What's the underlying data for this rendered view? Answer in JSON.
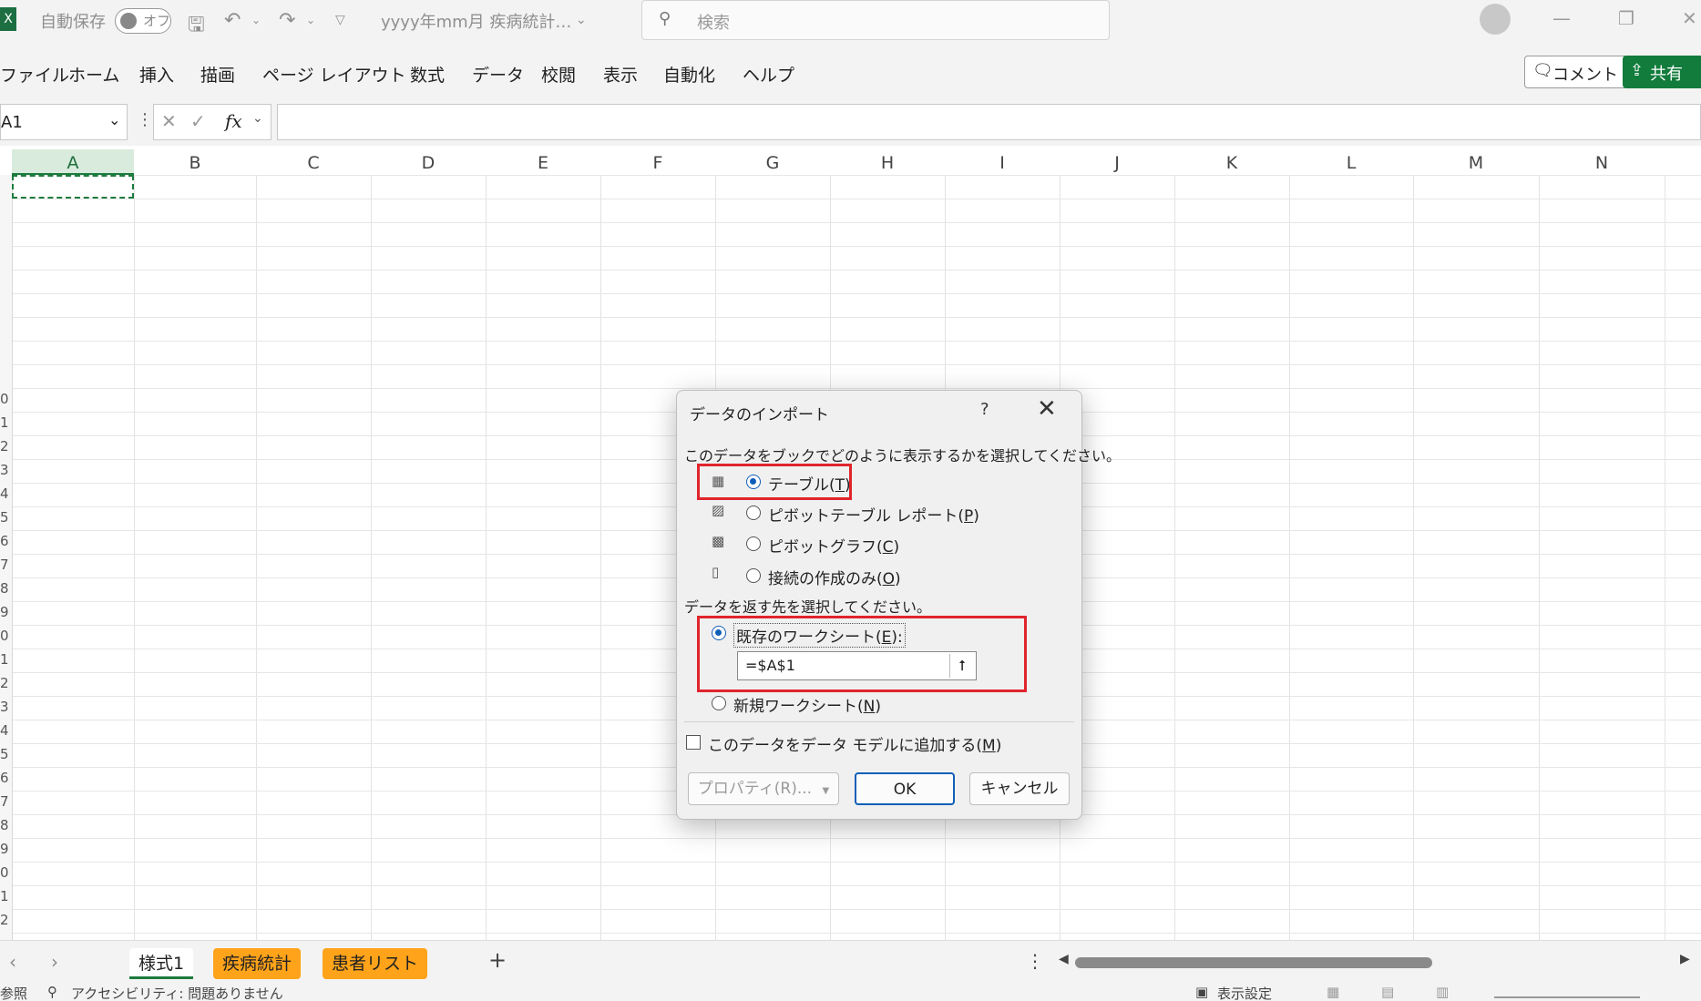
{
  "titlebar": {
    "autosave_label": "自動保存",
    "autosave_state": "オフ",
    "filename": "yyyy年mm月 疾病統計…",
    "search_placeholder": "検索"
  },
  "ribbon": {
    "tabs": [
      "ファイル",
      "ホーム",
      "挿入",
      "描画",
      "ページ レイアウト",
      "数式",
      "データ",
      "校閲",
      "表示",
      "自動化",
      "ヘルプ"
    ],
    "comment_label": "コメント",
    "share_label": "共有"
  },
  "formula_bar": {
    "name_box": "A1",
    "fx": "fx",
    "formula": ""
  },
  "grid": {
    "columns": [
      "A",
      "B",
      "C",
      "D",
      "E",
      "F",
      "G",
      "H",
      "I",
      "J",
      "K",
      "L",
      "M",
      "N"
    ],
    "row_fragments": [
      "0",
      "1",
      "2",
      "3",
      "4",
      "5",
      "6",
      "7",
      "8",
      "9",
      "0",
      "1",
      "2",
      "3",
      "4",
      "5",
      "6",
      "7",
      "8",
      "9",
      "0",
      "1",
      "2"
    ]
  },
  "sheet_tabs": {
    "tabs": [
      {
        "label": "様式1",
        "active": true,
        "color": ""
      },
      {
        "label": "疾病統計",
        "active": false,
        "color": "#ffa31a"
      },
      {
        "label": "患者リスト",
        "active": false,
        "color": "#ffa31a"
      }
    ],
    "add_label": "+"
  },
  "statusbar": {
    "left_fragment": "参照",
    "accessibility": "アクセシビリティ: 問題ありません",
    "display_settings": "表示設定"
  },
  "dialog": {
    "title": "データのインポート",
    "help": "?",
    "prompt_display": "このデータをブックでどのように表示するかを選択してください。",
    "display_options": [
      {
        "pre": "テーブル(",
        "key": "T",
        "post": ")",
        "selected": true,
        "icon": "table-icon"
      },
      {
        "pre": "ピボットテーブル レポート(",
        "key": "P",
        "post": ")",
        "selected": false,
        "icon": "pivot-table-icon"
      },
      {
        "pre": "ピボットグラフ(",
        "key": "C",
        "post": ")",
        "selected": false,
        "icon": "pivot-chart-icon"
      },
      {
        "pre": "接続の作成のみ(",
        "key": "O",
        "post": ")",
        "selected": false,
        "icon": "connection-icon"
      }
    ],
    "prompt_destination": "データを返す先を選択してください。",
    "dest_options": [
      {
        "pre": "既存のワークシート(",
        "key": "E",
        "post": "):",
        "selected": true
      },
      {
        "pre": "新規ワークシート(",
        "key": "N",
        "post": ")",
        "selected": false
      }
    ],
    "reference": "=$A$1",
    "data_model_checkbox": {
      "pre": "このデータをデータ モデルに追加する(",
      "key": "M",
      "post": ")",
      "checked": false
    },
    "buttons": {
      "properties": "プロパティ(R)...",
      "ok": "OK",
      "cancel": "キャンセル"
    }
  }
}
